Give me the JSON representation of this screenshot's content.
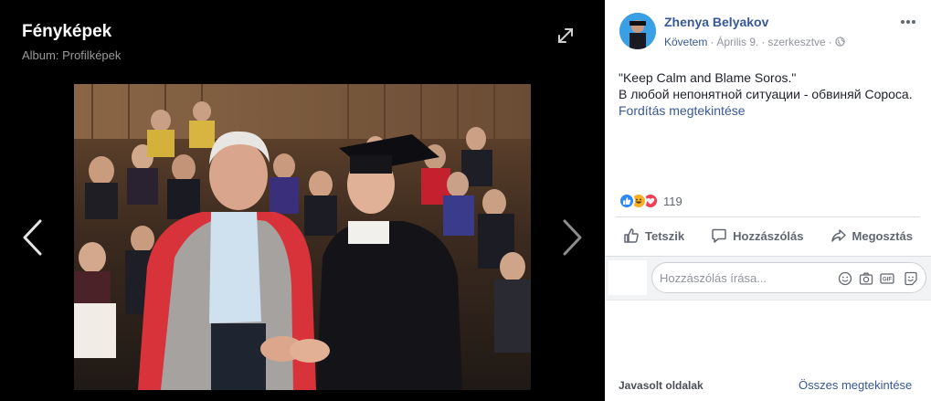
{
  "viewer": {
    "title": "Fényképek",
    "album": "Album: Profilképek",
    "icons": {
      "expand": "expand-icon",
      "prev": "chevron-left-icon",
      "next": "chevron-right-icon"
    }
  },
  "post": {
    "author": "Zhenya Belyakov",
    "follow": "Követem",
    "date": "Április 9.",
    "edited": "szerkesztve",
    "privacy_icon": "globe-icon",
    "text_lines": [
      "\"Keep Calm and Blame Soros.\"",
      "В любой непонятной ситуации - обвиняй Сороса."
    ],
    "translate": "Fordítás megtekintése",
    "reactions": {
      "icons": [
        "like-icon",
        "haha-icon",
        "love-icon"
      ],
      "count": "119"
    },
    "actions": {
      "like": "Tetszik",
      "comment": "Hozzászólás",
      "share": "Megosztás"
    },
    "comment_placeholder": "Hozzászólás írása...",
    "comment_icons": [
      "emoji-icon",
      "camera-icon",
      "gif-icon",
      "sticker-icon"
    ]
  },
  "suggested": {
    "label": "Javasolt oldalak",
    "see_all": "Összes megtekintése"
  },
  "colors": {
    "link": "#385898",
    "like": "#2d88ff",
    "haha": "#f7b125",
    "love": "#f33e58"
  }
}
